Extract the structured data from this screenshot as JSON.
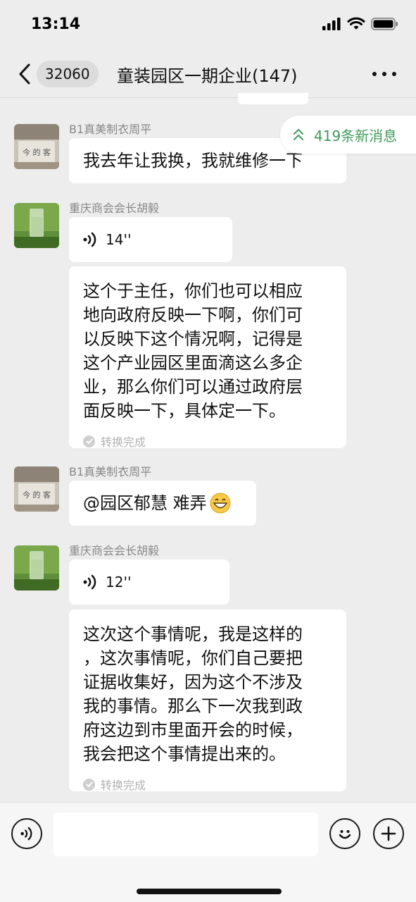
{
  "status_bar": {
    "time": "13:14"
  },
  "header": {
    "unread_count": "32060",
    "title": "童装园区一期企业(147)"
  },
  "new_messages": {
    "label": "419条新消息"
  },
  "messages": [
    {
      "sender": "B1真美制衣周平",
      "type": "text",
      "text": "我去年让我换，我就维修一下"
    },
    {
      "sender": "重庆商会会长胡毅",
      "type": "voice",
      "duration": "14''",
      "transcript": [
        "这个于主任，你们也可以相应",
        "地向政府反映一下啊，你们可",
        "以反映下这个情况啊，记得是",
        "这个产业园区里面滴这么多企",
        "业，那么你们可以通过政府层",
        "面反映一下，具体定一下。"
      ],
      "status": "转换完成"
    },
    {
      "sender": "B1真美制衣周平",
      "type": "text",
      "text": "@园区郁慧 难弄",
      "emoji": "grinning-face"
    },
    {
      "sender": "重庆商会会长胡毅",
      "type": "voice",
      "duration": "12''",
      "transcript": [
        "这次这个事情呢，我是这样的",
        "，这次事情呢，你们自己要把",
        "证据收集好，因为这个不涉及",
        "我的事情。那么下一次我到政",
        "府这边到市里面开会的时候，",
        "我会把这个事情提出来的。"
      ],
      "status": "转换完成"
    }
  ],
  "input_bar": {
    "text": ""
  },
  "colors": {
    "background": "#ededed",
    "bubble": "#ffffff",
    "accent_green": "#3f9a5a",
    "sender_gray": "#888888"
  },
  "icons": [
    "signal-icon",
    "wifi-icon",
    "battery-icon",
    "back-chevron-icon",
    "more-icon",
    "double-chevron-up-icon",
    "voice-wave-icon",
    "check-circle-icon",
    "voice-mode-icon",
    "emoji-icon",
    "plus-icon"
  ]
}
